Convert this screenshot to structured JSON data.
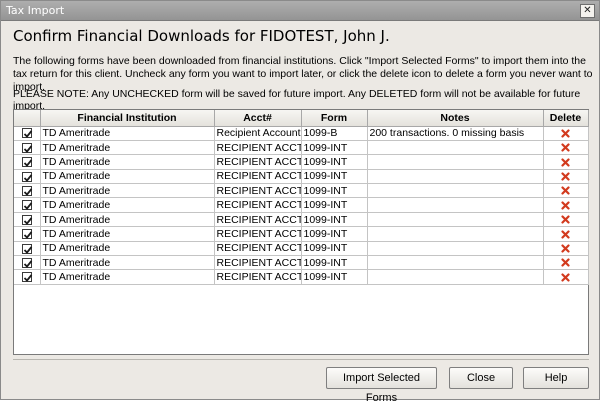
{
  "window": {
    "title": "Tax Import",
    "close_glyph": "✕"
  },
  "heading": "Confirm Financial Downloads for FIDOTEST, John J.",
  "intro": "The  following forms have been downloaded from financial institutions. Click \"Import Selected Forms\" to import them into the tax return for this client. Uncheck any form you want to import later, or click the delete icon to delete a form you never want to import.",
  "note": "PLEASE NOTE: Any UNCHECKED form will be saved for future import. Any DELETED form will not be available for future import.",
  "table": {
    "headers": {
      "institution": "Financial Institution",
      "acct": "Acct#",
      "form": "Form",
      "notes": "Notes",
      "delete": "Delete"
    },
    "rows": [
      {
        "checked": true,
        "institution": "TD Ameritrade",
        "acct": "Recipient Account #",
        "form": "1099-B",
        "notes": "200 transactions. 0 missing basis"
      },
      {
        "checked": true,
        "institution": "TD Ameritrade",
        "acct": "RECIPIENT ACCT NU",
        "form": "1099-INT",
        "notes": ""
      },
      {
        "checked": true,
        "institution": "TD Ameritrade",
        "acct": "RECIPIENT ACCT NU",
        "form": "1099-INT",
        "notes": ""
      },
      {
        "checked": true,
        "institution": "TD Ameritrade",
        "acct": "RECIPIENT ACCT NU",
        "form": "1099-INT",
        "notes": ""
      },
      {
        "checked": true,
        "institution": "TD Ameritrade",
        "acct": "RECIPIENT ACCT NU",
        "form": "1099-INT",
        "notes": ""
      },
      {
        "checked": true,
        "institution": "TD Ameritrade",
        "acct": "RECIPIENT ACCT NU",
        "form": "1099-INT",
        "notes": ""
      },
      {
        "checked": true,
        "institution": "TD Ameritrade",
        "acct": "RECIPIENT ACCT NU",
        "form": "1099-INT",
        "notes": ""
      },
      {
        "checked": true,
        "institution": "TD Ameritrade",
        "acct": "RECIPIENT ACCT NU",
        "form": "1099-INT",
        "notes": ""
      },
      {
        "checked": true,
        "institution": "TD Ameritrade",
        "acct": "RECIPIENT ACCT NU",
        "form": "1099-INT",
        "notes": ""
      },
      {
        "checked": true,
        "institution": "TD Ameritrade",
        "acct": "RECIPIENT ACCT NU",
        "form": "1099-INT",
        "notes": ""
      },
      {
        "checked": true,
        "institution": "TD Ameritrade",
        "acct": "RECIPIENT ACCT NU",
        "form": "1099-INT",
        "notes": ""
      }
    ]
  },
  "buttons": {
    "import": "Import Selected Forms",
    "close": "Close",
    "help": "Help"
  },
  "colors": {
    "delete_icon": "#d23a1e",
    "check_mark": "#1a1a1a"
  },
  "icons": {
    "checkbox": "check-mark-icon",
    "delete": "red-x-delete-icon"
  }
}
